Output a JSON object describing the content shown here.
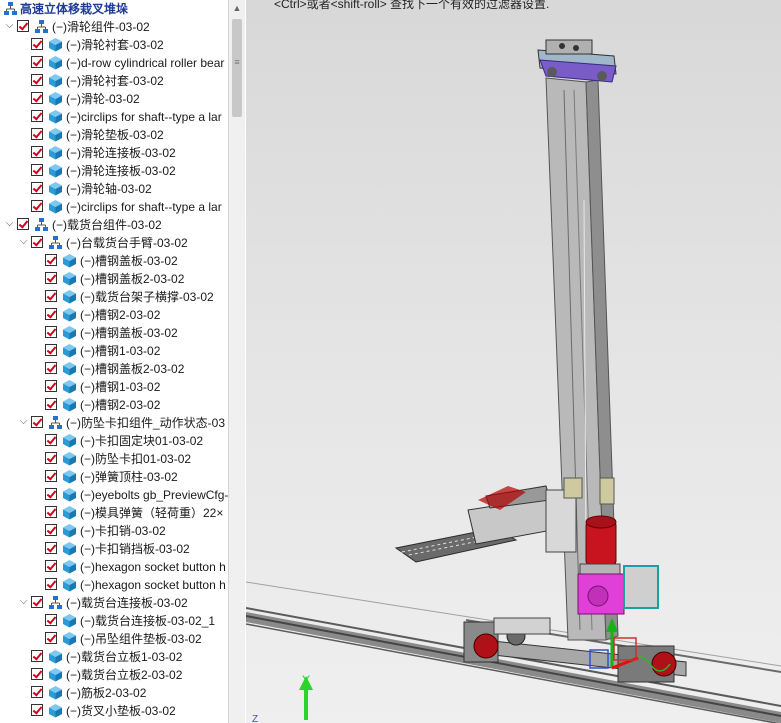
{
  "tree": {
    "items": [
      {
        "label": "高速立体移栽叉堆垛",
        "root": true,
        "indent": 0
      },
      {
        "label": "(−)滑轮组件-03-02",
        "type": "asm",
        "indent": 0,
        "expand": "v"
      },
      {
        "label": "(−)滑轮衬套-03-02",
        "type": "part",
        "indent": 1
      },
      {
        "label": "(−)d-row cylindrical roller bear",
        "type": "part",
        "indent": 1
      },
      {
        "label": "(−)滑轮衬套-03-02",
        "type": "part",
        "indent": 1
      },
      {
        "label": "(−)滑轮-03-02",
        "type": "part",
        "indent": 1
      },
      {
        "label": "(−)circlips for shaft--type a lar",
        "type": "part",
        "indent": 1
      },
      {
        "label": "(−)滑轮垫板-03-02",
        "type": "part",
        "indent": 1
      },
      {
        "label": "(−)滑轮连接板-03-02",
        "type": "part",
        "indent": 1
      },
      {
        "label": "(−)滑轮连接板-03-02",
        "type": "part",
        "indent": 1
      },
      {
        "label": "(−)滑轮轴-03-02",
        "type": "part",
        "indent": 1
      },
      {
        "label": "(−)circlips for shaft--type a lar",
        "type": "part",
        "indent": 1
      },
      {
        "label": "(−)载货台组件-03-02",
        "type": "asm",
        "indent": 0,
        "expand": "v"
      },
      {
        "label": "(−)台载货台手臂-03-02",
        "type": "asm",
        "indent": 1,
        "expand": "v"
      },
      {
        "label": "(−)槽钢盖板-03-02",
        "type": "part",
        "indent": 2
      },
      {
        "label": "(−)槽钢盖板2-03-02",
        "type": "part",
        "indent": 2
      },
      {
        "label": "(−)载货台架子横撑-03-02",
        "type": "part",
        "indent": 2
      },
      {
        "label": "(−)槽钢2-03-02",
        "type": "part",
        "indent": 2
      },
      {
        "label": "(−)槽钢盖板-03-02",
        "type": "part",
        "indent": 2
      },
      {
        "label": "(−)槽钢1-03-02",
        "type": "part",
        "indent": 2
      },
      {
        "label": "(−)槽钢盖板2-03-02",
        "type": "part",
        "indent": 2
      },
      {
        "label": "(−)槽钢1-03-02",
        "type": "part",
        "indent": 2
      },
      {
        "label": "(−)槽钢2-03-02",
        "type": "part",
        "indent": 2
      },
      {
        "label": "(−)防坠卡扣组件_动作状态-03",
        "type": "asm",
        "indent": 1,
        "expand": "v"
      },
      {
        "label": "(−)卡扣固定块01-03-02",
        "type": "part",
        "indent": 2
      },
      {
        "label": "(−)防坠卡扣01-03-02",
        "type": "part",
        "indent": 2
      },
      {
        "label": "(−)弹簧顶柱-03-02",
        "type": "part",
        "indent": 2
      },
      {
        "label": "(−)eyebolts gb_PreviewCfg-",
        "type": "part",
        "indent": 2
      },
      {
        "label": "(−)模具弹簧（轻荷重）22×",
        "type": "part",
        "indent": 2
      },
      {
        "label": "(−)卡扣销-03-02",
        "type": "part",
        "indent": 2
      },
      {
        "label": "(−)卡扣销挡板-03-02",
        "type": "part",
        "indent": 2
      },
      {
        "label": "(−)hexagon socket button h",
        "type": "part",
        "indent": 2
      },
      {
        "label": "(−)hexagon socket button h",
        "type": "part",
        "indent": 2
      },
      {
        "label": "(−)载货台连接板-03-02",
        "type": "asm",
        "indent": 1,
        "expand": "v"
      },
      {
        "label": "(−)载货台连接板-03-02_1",
        "type": "part",
        "indent": 2
      },
      {
        "label": "(−)吊坠组件垫板-03-02",
        "type": "part",
        "indent": 2
      },
      {
        "label": "(−)载货台立板1-03-02",
        "type": "part",
        "indent": 1
      },
      {
        "label": "(−)载货台立板2-03-02",
        "type": "part",
        "indent": 1
      },
      {
        "label": "(−)筋板2-03-02",
        "type": "part",
        "indent": 1
      },
      {
        "label": "(−)货叉小垫板-03-02",
        "type": "part",
        "indent": 1
      }
    ]
  },
  "viewport": {
    "hint": "<Ctrl>或者<shift-roll> 查找下一个有效的过滤器设置.",
    "axis_y_label": "Y",
    "axis_z_label": "Z"
  },
  "colors": {
    "check": "#d0021b",
    "part_icon": "#2a9bd6",
    "asm_icon": "#2a6fc9",
    "root_text": "#1e3c96",
    "motor": "#c8141e",
    "gearbox": "#e040d8",
    "purple": "#7a5cc8"
  }
}
